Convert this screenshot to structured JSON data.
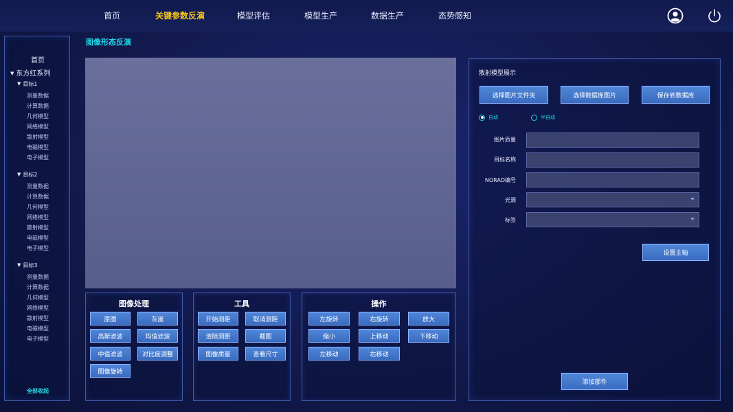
{
  "nav": {
    "items": [
      "首页",
      "关键参数反演",
      "模型评估",
      "模型生产",
      "数据生产",
      "态势感知"
    ],
    "active_index": 1,
    "user_icon": "user-icon",
    "power_icon": "power-icon"
  },
  "sidebar": {
    "home": "首页",
    "series": "东方红系列",
    "groups": [
      {
        "label": "目标1",
        "items": [
          "测量数据",
          "计算数据",
          "几何模型",
          "网络模型",
          "散射模型",
          "电磁模型",
          "电子模型"
        ]
      },
      {
        "label": "目标2",
        "items": [
          "测量数据",
          "计算数据",
          "几何模型",
          "网络模型",
          "散射模型",
          "电磁模型",
          "电子模型"
        ]
      },
      {
        "label": "目标3",
        "items": [
          "测量数据",
          "计算数据",
          "几何模型",
          "网络模型",
          "散射模型",
          "电磁模型",
          "电子模型"
        ]
      }
    ],
    "collapse_all": "全部收起"
  },
  "page_title": "图像形态反演",
  "panels": {
    "image_processing": {
      "title": "图像处理",
      "buttons": [
        "原图",
        "灰度",
        "高斯滤波",
        "均值滤波",
        "中值滤波",
        "对比度调整",
        "图像旋转"
      ]
    },
    "tools": {
      "title": "工具",
      "buttons": [
        "开始测距",
        "取消测距",
        "清除测距",
        "截图",
        "图像质量",
        "查看尺寸"
      ]
    },
    "operations": {
      "title": "操作",
      "buttons": [
        "左旋转",
        "右旋转",
        "放大",
        "缩小",
        "上移动",
        "下移动",
        "左移动",
        "右移动"
      ]
    }
  },
  "right_panel": {
    "title": "散射模型展示",
    "buttons": [
      "选择图片文件夹",
      "选择数据库图片",
      "保存到数据库"
    ],
    "modes": [
      "自动",
      "半自动"
    ],
    "selected_mode": 0,
    "fields": {
      "image_quality": {
        "label": "图片质量",
        "value": ""
      },
      "target_name": {
        "label": "目标名称",
        "value": ""
      },
      "norad_id": {
        "label": "NORAD编号",
        "value": ""
      },
      "light_source": {
        "label": "光源",
        "value": ""
      },
      "tag": {
        "label": "标签",
        "value": ""
      }
    },
    "set_axis": "设置主轴",
    "add_part": "添加部件"
  },
  "colors": {
    "accent_cyan": "#20d8e8",
    "active_nav": "#f5c518",
    "button": "#4a7ed2",
    "canvas": "#62679a"
  }
}
